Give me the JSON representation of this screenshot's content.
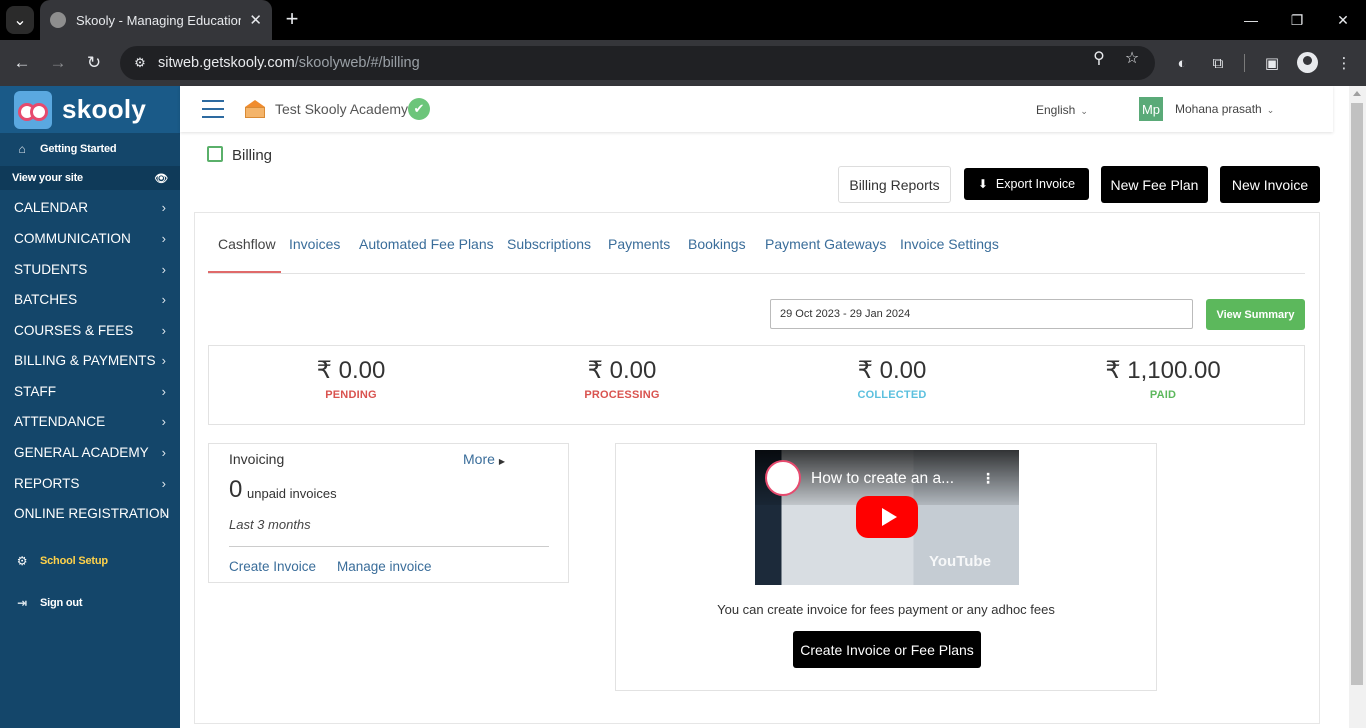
{
  "browser": {
    "tab_title": "Skooly - Managing Educational",
    "url_host": "sitweb.getskooly.com",
    "url_path": "/skoolyweb/#/billing"
  },
  "sidebar": {
    "logo": "skooly",
    "getting_started": "Getting Started",
    "view_site": "View your site",
    "menu": [
      {
        "label": "CALENDAR"
      },
      {
        "label": "COMMUNICATION"
      },
      {
        "label": "STUDENTS"
      },
      {
        "label": "BATCHES"
      },
      {
        "label": "COURSES & FEES"
      },
      {
        "label": "BILLING & PAYMENTS"
      },
      {
        "label": "STAFF"
      },
      {
        "label": "ATTENDANCE"
      },
      {
        "label": "GENERAL ACADEMY"
      },
      {
        "label": "REPORTS"
      },
      {
        "label": "ONLINE REGISTRATION"
      }
    ],
    "school_setup": "School Setup",
    "sign_out": "Sign out"
  },
  "header": {
    "school_name": "Test Skooly Academy",
    "language": "English",
    "avatar_initials": "Mp",
    "user_name": "Mohana prasath"
  },
  "page": {
    "title": "Billing",
    "buttons": {
      "billing_reports": "Billing Reports",
      "export_invoice": "Export Invoice",
      "new_fee_plan": "New Fee Plan",
      "new_invoice": "New Invoice"
    },
    "tabs": [
      {
        "label": "Cashflow",
        "active": true
      },
      {
        "label": "Invoices"
      },
      {
        "label": "Automated Fee Plans"
      },
      {
        "label": "Subscriptions"
      },
      {
        "label": "Payments"
      },
      {
        "label": "Bookings"
      },
      {
        "label": "Payment Gateways"
      },
      {
        "label": "Invoice Settings"
      }
    ],
    "date_range": "29 Oct 2023 - 29 Jan 2024",
    "view_summary": "View Summary",
    "stats": [
      {
        "amount": "₹ 0.00",
        "label": "PENDING",
        "color": "#d9534f"
      },
      {
        "amount": "₹ 0.00",
        "label": "PROCESSING",
        "color": "#d9534f"
      },
      {
        "amount": "₹ 0.00",
        "label": "COLLECTED",
        "color": "#5bc0de"
      },
      {
        "amount": "₹ 1,100.00",
        "label": "PAID",
        "color": "#5cb85c"
      }
    ],
    "invoicing": {
      "title": "Invoicing",
      "more": "More",
      "count": "0",
      "count_label": "unpaid invoices",
      "period": "Last 3 months",
      "create_invoice": "Create Invoice",
      "manage_invoice": "Manage invoice"
    },
    "video": {
      "title": "How to create an a...",
      "watermark": "YouTube",
      "description": "You can create invoice for fees payment or any adhoc fees",
      "cta": "Create Invoice or Fee Plans"
    }
  },
  "colors": {
    "sidebar_bg": "#14466a",
    "link": "#3a6d9a",
    "success": "#5cb85c",
    "school_setup": "#ffd24a"
  }
}
